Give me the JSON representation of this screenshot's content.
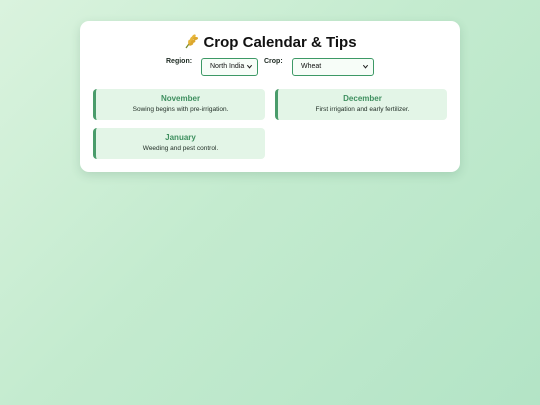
{
  "page": {
    "title": "Crop Calendar & Tips",
    "title_icon": "wheat-icon"
  },
  "filters": {
    "region_label": "Region:",
    "region_value": "North India",
    "crop_label": "Crop:",
    "crop_value": "Wheat"
  },
  "calendar": {
    "months": [
      {
        "month": "November",
        "tip": "Sowing begins with pre-irrigation."
      },
      {
        "month": "December",
        "tip": "First irrigation and early fertilizer."
      },
      {
        "month": "January",
        "tip": "Weeding and pest control."
      }
    ]
  },
  "colors": {
    "accent": "#3e8f5f",
    "card_bg": "#e3f5e7",
    "card_border": "#4a9c6b",
    "select_border": "#3d9966"
  }
}
